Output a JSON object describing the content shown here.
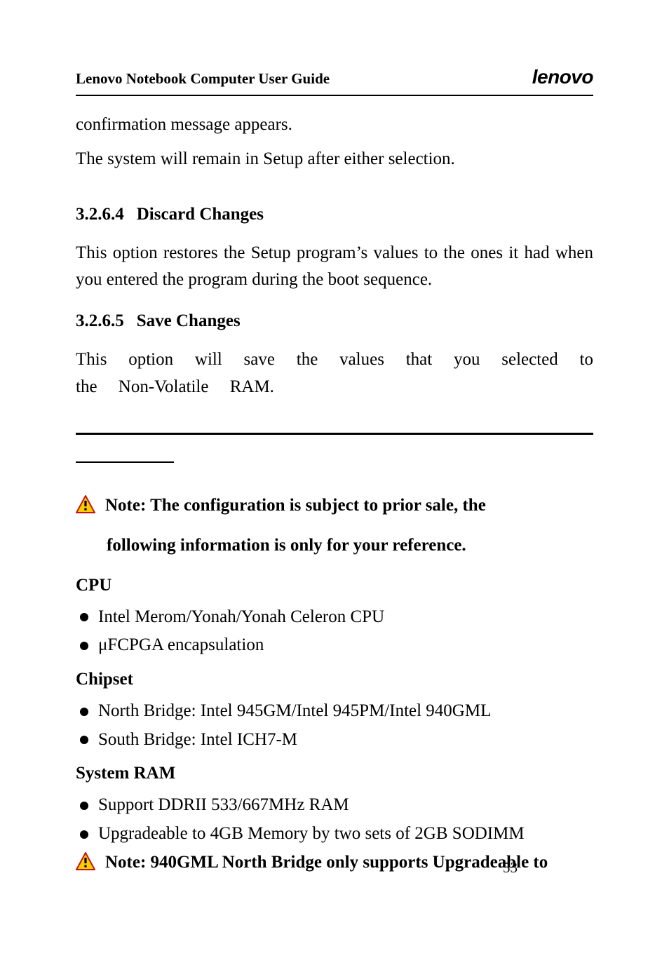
{
  "header": {
    "title": "Lenovo Notebook Computer User Guide",
    "brand": "lenovo"
  },
  "intro": {
    "line1": "confirmation message appears.",
    "line2": "The system will remain in Setup after either selection."
  },
  "sections": {
    "s1": {
      "num": "3.2.6.4",
      "title": "Discard Changes",
      "body": "This option restores the Setup program’s values to the ones it had when you entered the program during the boot sequence."
    },
    "s2": {
      "num": "3.2.6.5",
      "title": "Save Changes",
      "body": "This option will save the values that you selected to the Non‑Volatile RAM."
    }
  },
  "note1": {
    "line1": "Note: The configuration is subject to prior sale, the",
    "line2": "following information is only for your reference."
  },
  "specs": {
    "cpu": {
      "head": "CPU",
      "items": [
        "Intel Merom/Yonah/Yonah Celeron CPU",
        "μFCPGA encapsulation"
      ]
    },
    "chipset": {
      "head": "Chipset",
      "items": [
        "North Bridge: Intel 945GM/Intel 945PM/Intel 940GML",
        "South Bridge: Intel ICH7‑M"
      ]
    },
    "ram": {
      "head": "System RAM",
      "items": [
        "Support DDRII 533/667MHz RAM",
        "Upgradeable to 4GB Memory by two sets of 2GB SODIMM"
      ]
    }
  },
  "note2": "Note: 940GML North Bridge only supports Upgradeable to",
  "pageNumber": "53"
}
